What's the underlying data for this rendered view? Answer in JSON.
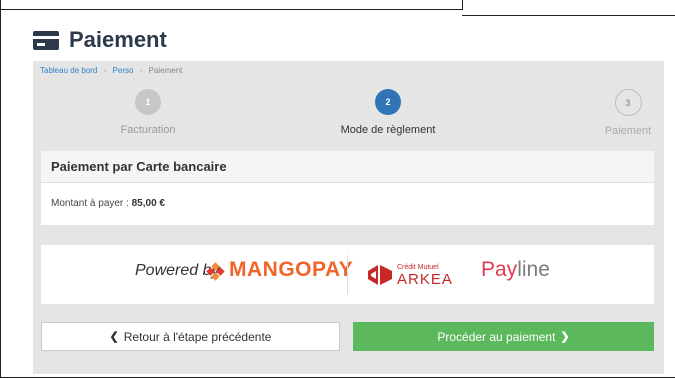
{
  "page": {
    "title": "Paiement",
    "icon": "credit-card-icon"
  },
  "breadcrumb": [
    {
      "label": "Tableau de bord"
    },
    {
      "label": "Perso"
    },
    {
      "label": "Paiement"
    }
  ],
  "breadcrumb_separator": "›",
  "steps": [
    {
      "number": "1",
      "label": "Facturation",
      "state": "done"
    },
    {
      "number": "2",
      "label": "Mode de règlement",
      "state": "active"
    },
    {
      "number": "3",
      "label": "Paiement",
      "state": "pending"
    }
  ],
  "payment_card": {
    "header": "Paiement par Carte bancaire",
    "amount_label": "Montant à payer : ",
    "amount_value": "85,00 €"
  },
  "logos": {
    "powered_by": "Powered by",
    "mangopay": "MANGOPAY",
    "credit_mutuel": "Crédit Mutuel",
    "arkea": "ARKEA",
    "payline_pay": "Pay",
    "payline_line": "line"
  },
  "buttons": {
    "back_label": "Retour à l'étape précédente",
    "back_icon": "chevron-left-icon",
    "pay_label": "Procéder au paiement",
    "pay_icon": "chevron-right-icon"
  },
  "colors": {
    "accent": "#2f75b5",
    "pay_button": "#5cb85c",
    "mangopay": "#f0662a",
    "arkea": "#c62828"
  }
}
